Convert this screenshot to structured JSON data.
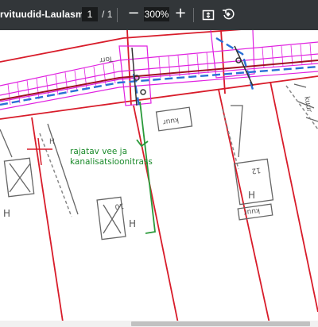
{
  "toolbar": {
    "doc_title": "rvituudid-Laulasma...",
    "page_current": "1",
    "page_separator": "/",
    "page_total": "1",
    "zoom_out_symbol": "−",
    "zoom_level": "300%",
    "zoom_in_symbol": "+",
    "fit_icon": "fit-to-page-icon",
    "rotate_icon": "rotate-icon"
  },
  "map": {
    "annotation_line1": "rajatav vee ja",
    "annotation_line2": "kanalisatsioonitrass",
    "label_torr": "Torr",
    "label_kuur1": "kuur",
    "label_kuur2": "kuur",
    "label_kuur3": "kuur",
    "label_h1": "H",
    "label_h2": "H",
    "label_h3": "H",
    "label_h4": "H",
    "label_10": "10",
    "label_12": "12",
    "colors": {
      "boundary": "#d81c2a",
      "utility": "#e020e0",
      "water": "#2a6fd6",
      "annotation": "#1a8a2a"
    }
  }
}
